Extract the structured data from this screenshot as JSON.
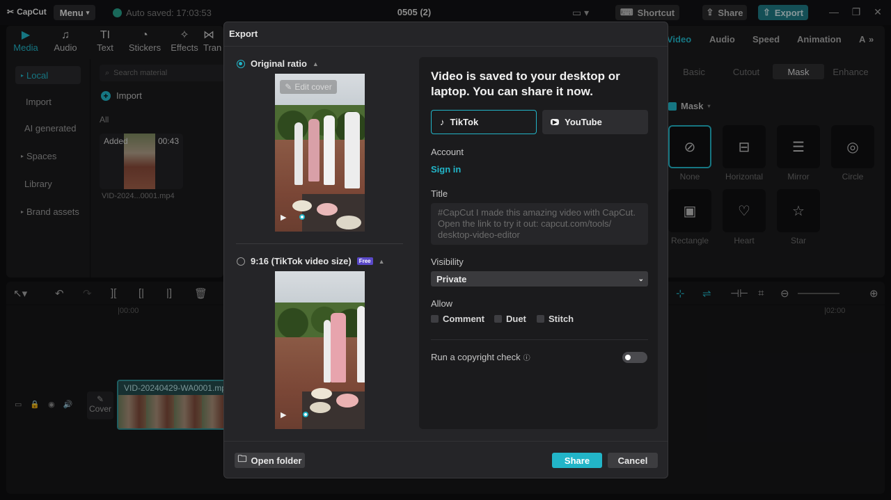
{
  "app": {
    "logo": "CapCut",
    "menu": "Menu",
    "autosave": "Auto saved: 17:03:53",
    "project_title": "0505 (2)",
    "shortcut": "Shortcut",
    "share": "Share",
    "export": "Export"
  },
  "left": {
    "tabs": [
      {
        "label": "Media",
        "icon": "media-icon"
      },
      {
        "label": "Audio",
        "icon": "audio-icon"
      },
      {
        "label": "Text",
        "icon": "text-icon"
      },
      {
        "label": "Stickers",
        "icon": "stickers-icon"
      },
      {
        "label": "Effects",
        "icon": "effects-icon"
      },
      {
        "label": "Tran",
        "icon": "transitions-icon"
      }
    ],
    "sidebar": [
      "Local",
      "Import",
      "AI generated",
      "Spaces",
      "Library",
      "Brand assets"
    ],
    "search_placeholder": "Search material",
    "import": "Import",
    "all": "All",
    "media": {
      "badge": "Added",
      "duration": "00:43",
      "name": "VID-2024...0001.mp4"
    }
  },
  "right": {
    "tabs": [
      "Video",
      "Audio",
      "Speed",
      "Animation",
      "A"
    ],
    "subtabs": [
      "Basic",
      "Cutout",
      "Mask",
      "Enhance"
    ],
    "mask_label": "Mask",
    "masks": [
      "None",
      "Horizontal",
      "Mirror",
      "Circle",
      "Rectangle",
      "Heart",
      "Star"
    ]
  },
  "timeline": {
    "ruler": [
      "|00:00",
      "|02:00"
    ],
    "cover": "Cover",
    "clip_name": "VID-20240429-WA0001.mp"
  },
  "export": {
    "title": "Export",
    "ratio1": "Original ratio",
    "edit_cover": "Edit cover",
    "ratio2": "9:16 (TikTok video size)",
    "free": "Free",
    "headline": "Video is saved to your desktop or laptop. You can share it now.",
    "platforms": [
      "TikTok",
      "YouTube"
    ],
    "account_label": "Account",
    "sign_in": "Sign in",
    "title_label": "Title",
    "title_placeholder": "#CapCut I made this amazing video with CapCut.\nOpen the link to try it out: capcut.com/tools/\ndesktop-video-editor",
    "visibility_label": "Visibility",
    "visibility_value": "Private",
    "allow_label": "Allow",
    "allow_opts": [
      "Comment",
      "Duet",
      "Stitch"
    ],
    "copyright_label": "Run a copyright check",
    "open_folder": "Open folder",
    "share": "Share",
    "cancel": "Cancel"
  }
}
